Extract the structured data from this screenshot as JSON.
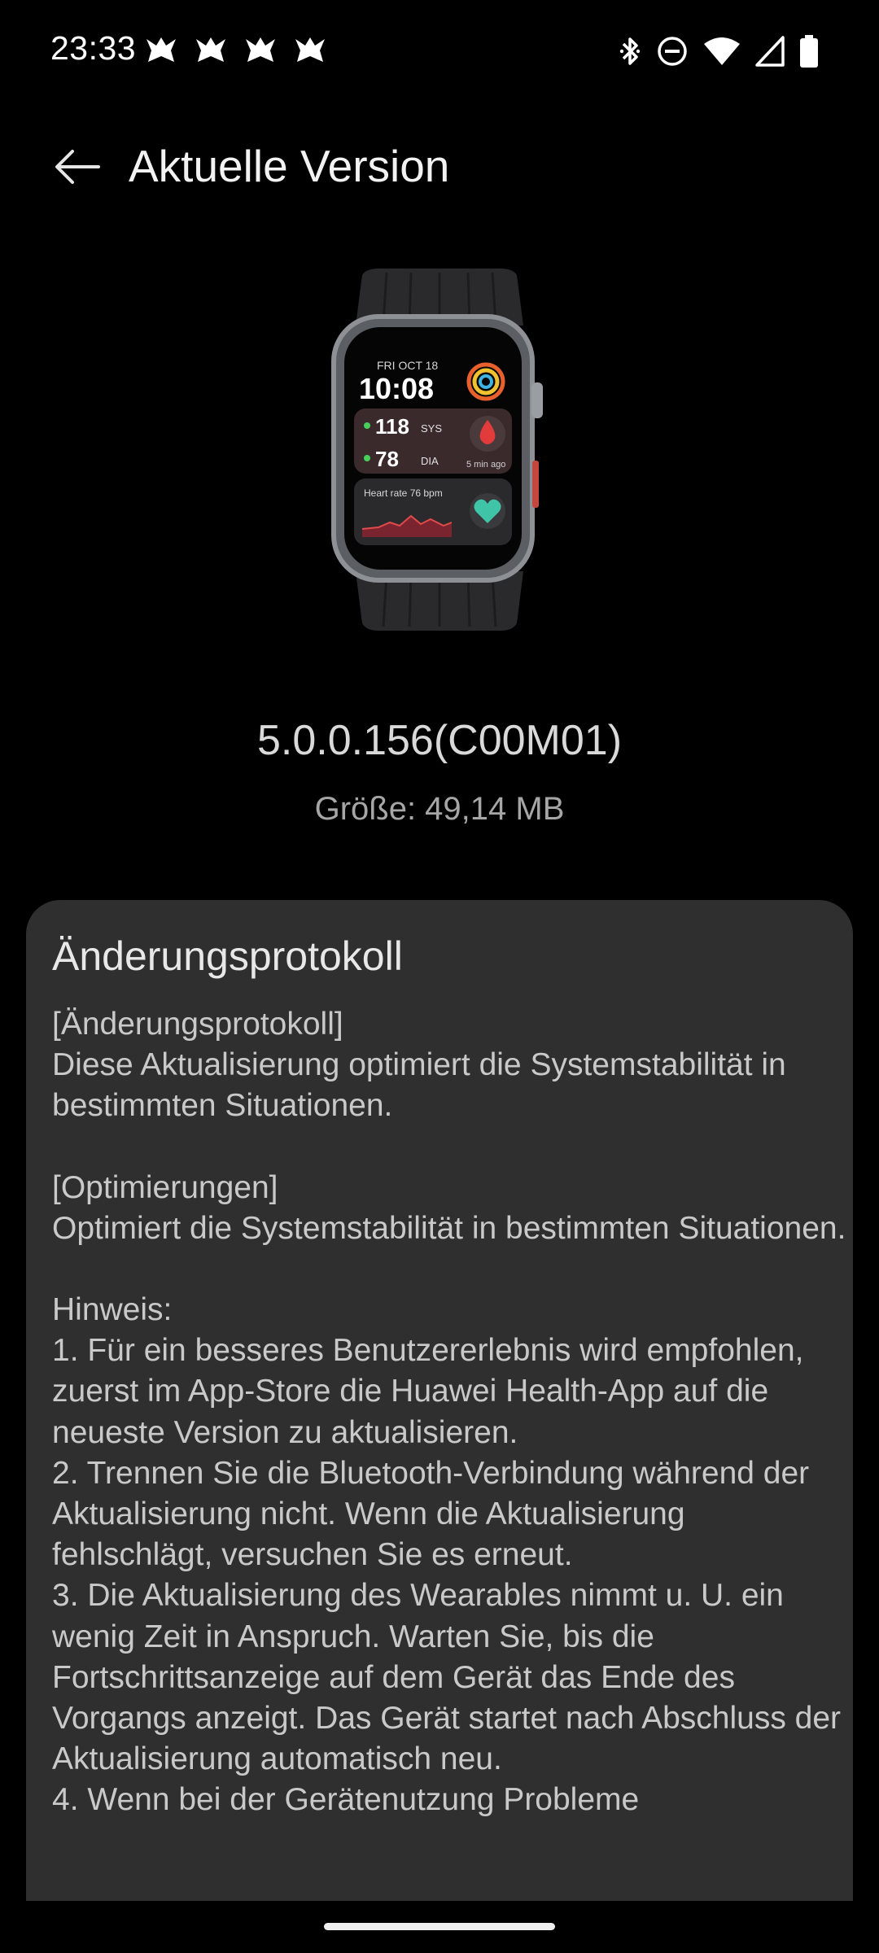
{
  "status_bar": {
    "time": "23:33",
    "notification_icons": [
      "bird-icon",
      "bird-icon",
      "bird-icon",
      "bird-icon"
    ],
    "system_icons": [
      "bluetooth-icon",
      "do-not-disturb-icon",
      "wifi-icon",
      "signal-icon",
      "battery-icon"
    ]
  },
  "app_bar": {
    "title": "Aktuelle Version",
    "back_icon": "arrow-left-icon"
  },
  "device": {
    "image": "smartwatch-image",
    "watch_face": {
      "date": "FRI OCT 18",
      "time": "10:08",
      "sys_value": "118",
      "sys_label": "SYS",
      "dia_value": "78",
      "dia_label": "DIA",
      "measured": "5 min ago",
      "heart_rate": "Heart rate 76 bpm"
    }
  },
  "version": {
    "number": "5.0.0.156(C00M01)",
    "size": "Größe: 49,14 MB"
  },
  "changelog": {
    "title": "Änderungsprotokoll",
    "sections": {
      "log_header": "[Änderungsprotokoll]",
      "log_text": "Diese Aktualisierung optimiert die Systemstabilität in bestimmten Situationen.",
      "opt_header": "[Optimierungen]",
      "opt_text": "Optimiert die Systemstabilität in bestimmten Situationen.",
      "note_header": "Hinweis:",
      "note_1": "1. Für ein besseres Benutzererlebnis wird empfohlen, zuerst im App-Store die Huawei Health-App auf die neueste Version zu aktualisieren.",
      "note_2": "2. Trennen Sie die Bluetooth-Verbindung während der Aktualisierung nicht. Wenn die Aktualisierung fehlschlägt, versuchen Sie es erneut.",
      "note_3": "3. Die Aktualisierung des Wearables nimmt u. U. ein wenig Zeit in Anspruch. Warten Sie, bis die Fortschrittsanzeige auf dem Gerät das Ende des Vorgangs anzeigt. Das Gerät startet nach Abschluss der Aktualisierung automatisch neu.",
      "note_4": "4. Wenn bei der Gerätenutzung Probleme"
    }
  },
  "colors": {
    "background": "#000000",
    "card": "#2f2f2f",
    "text_primary": "#e8e8e8",
    "text_secondary": "#a6a6a6"
  }
}
